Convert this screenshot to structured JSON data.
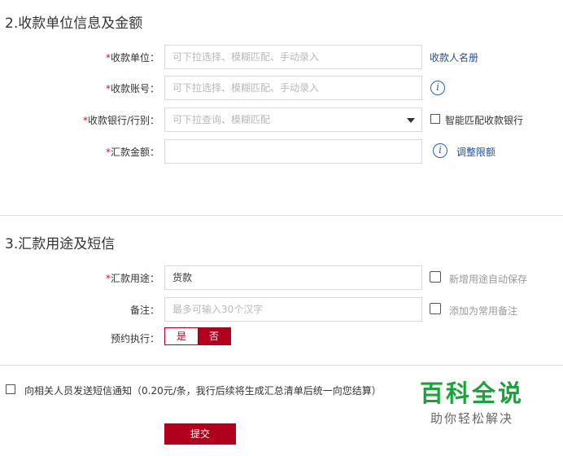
{
  "section2": {
    "title": "2.收款单位信息及金额",
    "payee_unit": {
      "label": "收款单位：",
      "placeholder": "可下拉选择、模糊匹配、手动录入",
      "link": "收款人名册"
    },
    "payee_account": {
      "label": "收款账号：",
      "placeholder": "可下拉选择、模糊匹配、手动录入"
    },
    "payee_bank": {
      "label": "收款银行/行别：",
      "placeholder": "可下拉查询、模糊匹配",
      "checkbox_label": "智能匹配收款银行"
    },
    "amount": {
      "label": "汇款金额：",
      "value": "",
      "link": "调整限额"
    },
    "required_mark": "*",
    "info_icon_glyph": "i"
  },
  "section3": {
    "title": "3.汇款用途及短信",
    "purpose": {
      "label": "汇款用途：",
      "value": "货款",
      "checkbox_label": "新增用途自动保存"
    },
    "remark": {
      "label": "备注：",
      "placeholder": "最多可输入30个汉字",
      "checkbox_label": "添加为常用备注"
    },
    "schedule": {
      "label": "预约执行：",
      "yes": "是",
      "no": "否",
      "selected": "否"
    }
  },
  "sms_notice": {
    "label": "向相关人员发送短信通知（0.20元/条，我行后续将生成汇总清单后统一向您结算）"
  },
  "submit": {
    "label": "提交"
  },
  "watermark": {
    "main": "百科全说",
    "sub": "助你轻松解决"
  },
  "colors": {
    "accent_red": "#b0001e",
    "link_blue": "#1f4fa0",
    "watermark_green": "#1aa33a"
  },
  "icons": {
    "info": "info-icon",
    "dropdown": "chevron-down-icon"
  }
}
